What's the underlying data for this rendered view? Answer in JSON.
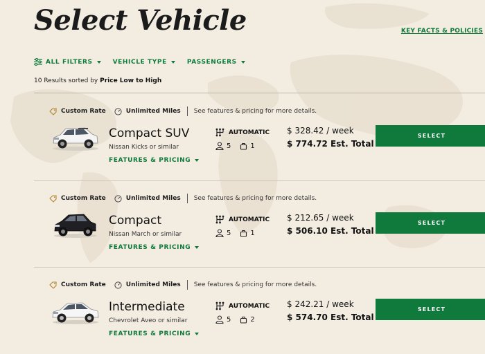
{
  "page": {
    "title": "Select Vehicle",
    "key_facts_link": "KEY FACTS & POLICIES"
  },
  "filters": [
    {
      "label": "ALL FILTERS",
      "icon": "sliders-icon"
    },
    {
      "label": "VEHICLE TYPE"
    },
    {
      "label": "PASSENGERS"
    }
  ],
  "results": {
    "count_text": "10 Results sorted by ",
    "sort_value": "Price Low to High"
  },
  "common": {
    "custom_rate": "Custom Rate",
    "unlimited_miles": "Unlimited Miles",
    "note": "See features & pricing for more details.",
    "features_label": "FEATURES & PRICING",
    "select_label": "SELECT"
  },
  "vehicles": [
    {
      "name": "Compact SUV",
      "similar": "Nissan Kicks or similar",
      "transmission": "AUTOMATIC",
      "passengers": "5",
      "bags": "1",
      "weekly": "$ 328.42 / week",
      "total": "$ 774.72 Est. Total",
      "car_color": "white-suv"
    },
    {
      "name": "Compact",
      "similar": "Nissan March or similar",
      "transmission": "AUTOMATIC",
      "passengers": "5",
      "bags": "1",
      "weekly": "$ 212.65 / week",
      "total": "$ 506.10 Est. Total",
      "car_color": "black-hatchback"
    },
    {
      "name": "Intermediate",
      "similar": "Chevrolet Aveo or similar",
      "transmission": "AUTOMATIC",
      "passengers": "5",
      "bags": "2",
      "weekly": "$ 242.21 / week",
      "total": "$ 574.70 Est. Total",
      "car_color": "white-sedan"
    }
  ],
  "colors": {
    "accent": "#0f7a3c",
    "background": "#f3ece1"
  }
}
